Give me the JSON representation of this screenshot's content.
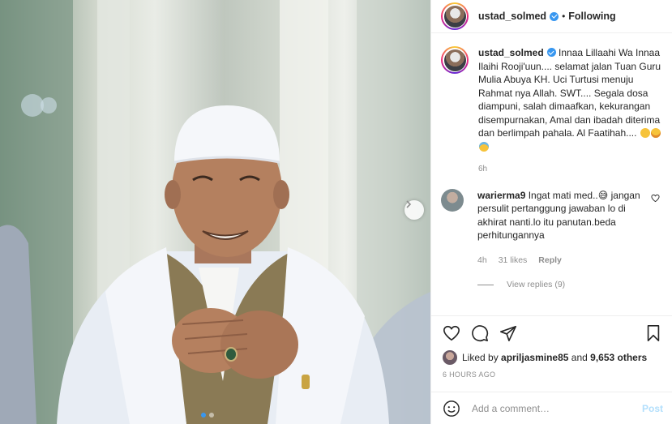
{
  "post": {
    "username": "ustad_solmed",
    "separator": "•",
    "follow_label": "Following",
    "image_alt": "photo",
    "carousel": {
      "count": 2,
      "active_index": 0
    }
  },
  "caption": {
    "username": "ustad_solmed",
    "text": "Innaa Lillaahi Wa Innaa Ilaihi Rooji'uun.... selamat jalan Tuan Guru Mulia Abuya KH. Uci Turtusi menuju Rahmat nya Allah. SWT.... Segala dosa diampuni, salah dimaafkan, kekurangan disempurnakan, Amal dan ibadah diterima dan berlimpah pahala. Al Faatihah....",
    "emojis": [
      "folded-hands-emoji",
      "smiling-face-emoji",
      "crying-face-emoji"
    ],
    "time": "6h"
  },
  "comments": [
    {
      "username": "warierma9",
      "text": "Ingat mati med..😅 jangan persulit pertanggung jawaban lo di akhirat nanti.lo itu panutan.beda perhitungannya",
      "time": "4h",
      "likes": "31 likes",
      "reply_label": "Reply",
      "view_replies": "View replies (9)"
    }
  ],
  "likes": {
    "prefix": "Liked by",
    "user": "apriljasmine85",
    "joiner": "and",
    "others": "9,653 others"
  },
  "date": "6 HOURS AGO",
  "add_comment": {
    "placeholder": "Add a comment…",
    "post_label": "Post"
  },
  "colors": {
    "verified": "#3897f0",
    "post_disabled": "#b2dffc",
    "meta_gray": "#8e8e8e"
  },
  "icons": [
    "verified-badge-icon",
    "heart-icon",
    "comment-icon",
    "share-icon",
    "bookmark-icon",
    "smiley-icon",
    "chevron-right-icon"
  ]
}
